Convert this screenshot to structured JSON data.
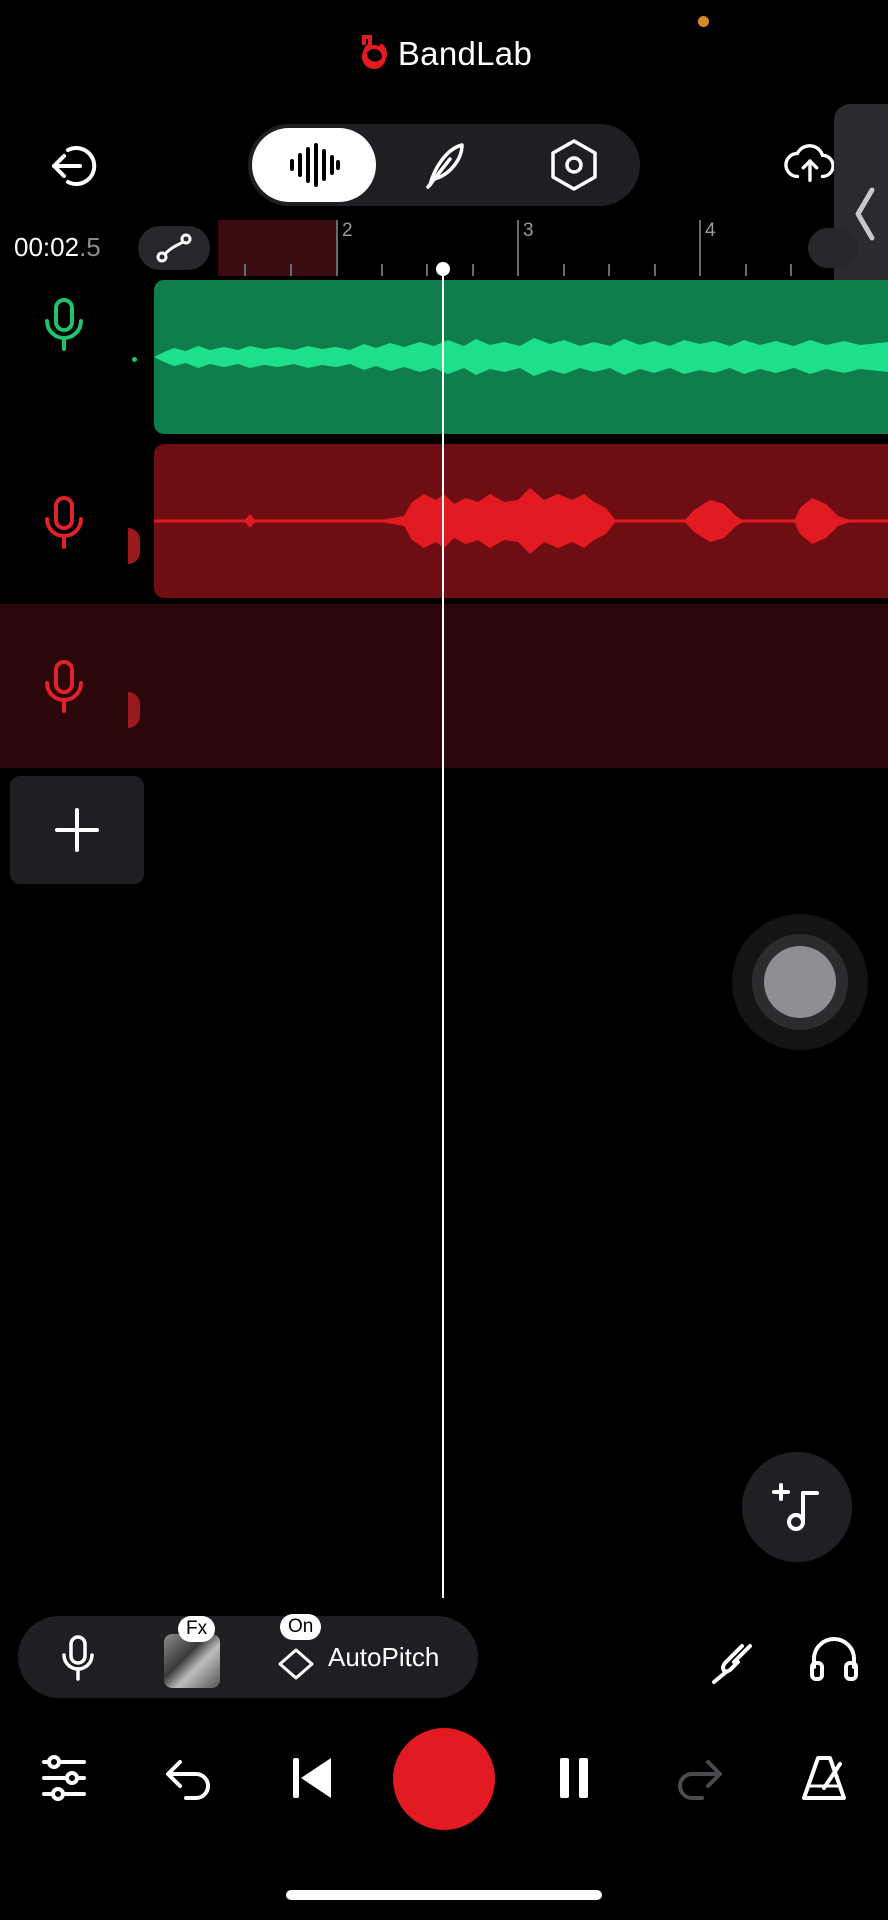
{
  "app": {
    "brand_name": "BandLab",
    "brand_color": "#e21b22"
  },
  "header": {
    "exit_icon": "exit-icon",
    "mode_tabs": [
      {
        "icon": "waveform-icon",
        "active": true
      },
      {
        "icon": "feather-icon",
        "active": false
      },
      {
        "icon": "hexagon-settings-icon",
        "active": false
      }
    ],
    "upload_icon": "cloud-upload-icon",
    "side_panel_icon": "chevron-left-icon"
  },
  "timeline": {
    "time_main": "00:02",
    "time_fraction": ".5",
    "ruler_numbers": [
      "2",
      "3",
      "4"
    ]
  },
  "tracks": [
    {
      "name": "voice-track-1",
      "color": "#22c16b",
      "clip_color": "#0f7d4c",
      "wave_color": "#1fe08a"
    },
    {
      "name": "voice-track-2",
      "color": "#e0232b",
      "clip_color": "#6e0e12",
      "wave_color": "#e21b22"
    },
    {
      "name": "voice-track-3",
      "color": "#e0232b",
      "lane_color": "#2c0709"
    }
  ],
  "input_bar": {
    "fx_badge": "Fx",
    "on_badge": "On",
    "autopitch_label": "AutoPitch"
  },
  "transport": {
    "mixer_icon": "sliders-icon",
    "undo_icon": "undo-icon",
    "skip_back_icon": "skip-back-icon",
    "record_icon": "record-icon",
    "pause_icon": "pause-icon",
    "redo_icon": "redo-icon",
    "metronome_icon": "metronome-icon"
  }
}
